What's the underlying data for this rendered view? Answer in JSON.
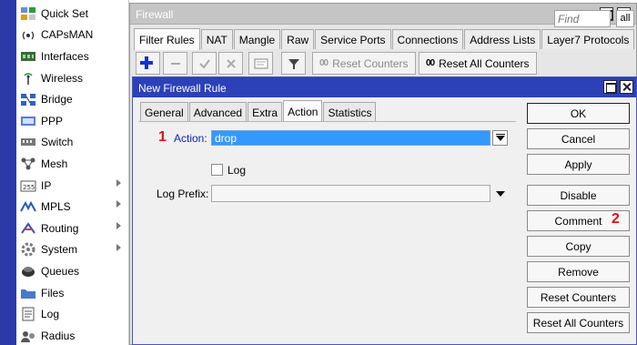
{
  "sidebar": {
    "items": [
      {
        "label": "Quick Set",
        "icon": "quick-set-icon",
        "submenu": false
      },
      {
        "label": "CAPsMAN",
        "icon": "capsman-icon",
        "submenu": false
      },
      {
        "label": "Interfaces",
        "icon": "interfaces-icon",
        "submenu": false
      },
      {
        "label": "Wireless",
        "icon": "wireless-icon",
        "submenu": false
      },
      {
        "label": "Bridge",
        "icon": "bridge-icon",
        "submenu": false
      },
      {
        "label": "PPP",
        "icon": "ppp-icon",
        "submenu": false
      },
      {
        "label": "Switch",
        "icon": "switch-icon",
        "submenu": false
      },
      {
        "label": "Mesh",
        "icon": "mesh-icon",
        "submenu": false
      },
      {
        "label": "IP",
        "icon": "ip-icon",
        "submenu": true
      },
      {
        "label": "MPLS",
        "icon": "mpls-icon",
        "submenu": true
      },
      {
        "label": "Routing",
        "icon": "routing-icon",
        "submenu": true
      },
      {
        "label": "System",
        "icon": "system-icon",
        "submenu": true
      },
      {
        "label": "Queues",
        "icon": "queues-icon",
        "submenu": false
      },
      {
        "label": "Files",
        "icon": "files-icon",
        "submenu": false
      },
      {
        "label": "Log",
        "icon": "log-icon",
        "submenu": false
      },
      {
        "label": "Radius",
        "icon": "radius-icon",
        "submenu": false
      }
    ]
  },
  "firewall": {
    "title": "Firewall",
    "tabs": [
      "Filter Rules",
      "NAT",
      "Mangle",
      "Raw",
      "Service Ports",
      "Connections",
      "Address Lists",
      "Layer7 Protocols"
    ],
    "active_tab": "Filter Rules",
    "toolbar": {
      "reset_counters": "Reset Counters",
      "reset_all_counters": "Reset All Counters",
      "counter_glyph": "00"
    },
    "find_placeholder": "Find",
    "filter_scope": "all"
  },
  "dialog": {
    "title": "New Firewall Rule",
    "tabs": [
      "General",
      "Advanced",
      "Extra",
      "Action",
      "Statistics"
    ],
    "active_tab": "Action",
    "action_label": "Action:",
    "action_value": "drop",
    "log_label": "Log",
    "log_checked": false,
    "log_prefix_label": "Log Prefix:",
    "log_prefix_value": "",
    "buttons": [
      "OK",
      "Cancel",
      "Apply",
      "Disable",
      "Comment",
      "Copy",
      "Remove",
      "Reset Counters",
      "Reset All Counters"
    ]
  },
  "annotations": {
    "step1": "1",
    "step2": "2"
  },
  "colors": {
    "sidebar_rail": "#2c3aa8",
    "dialog_titlebar": "#2c40b8",
    "selection": "#3399ff",
    "annotation": "#e01212"
  }
}
